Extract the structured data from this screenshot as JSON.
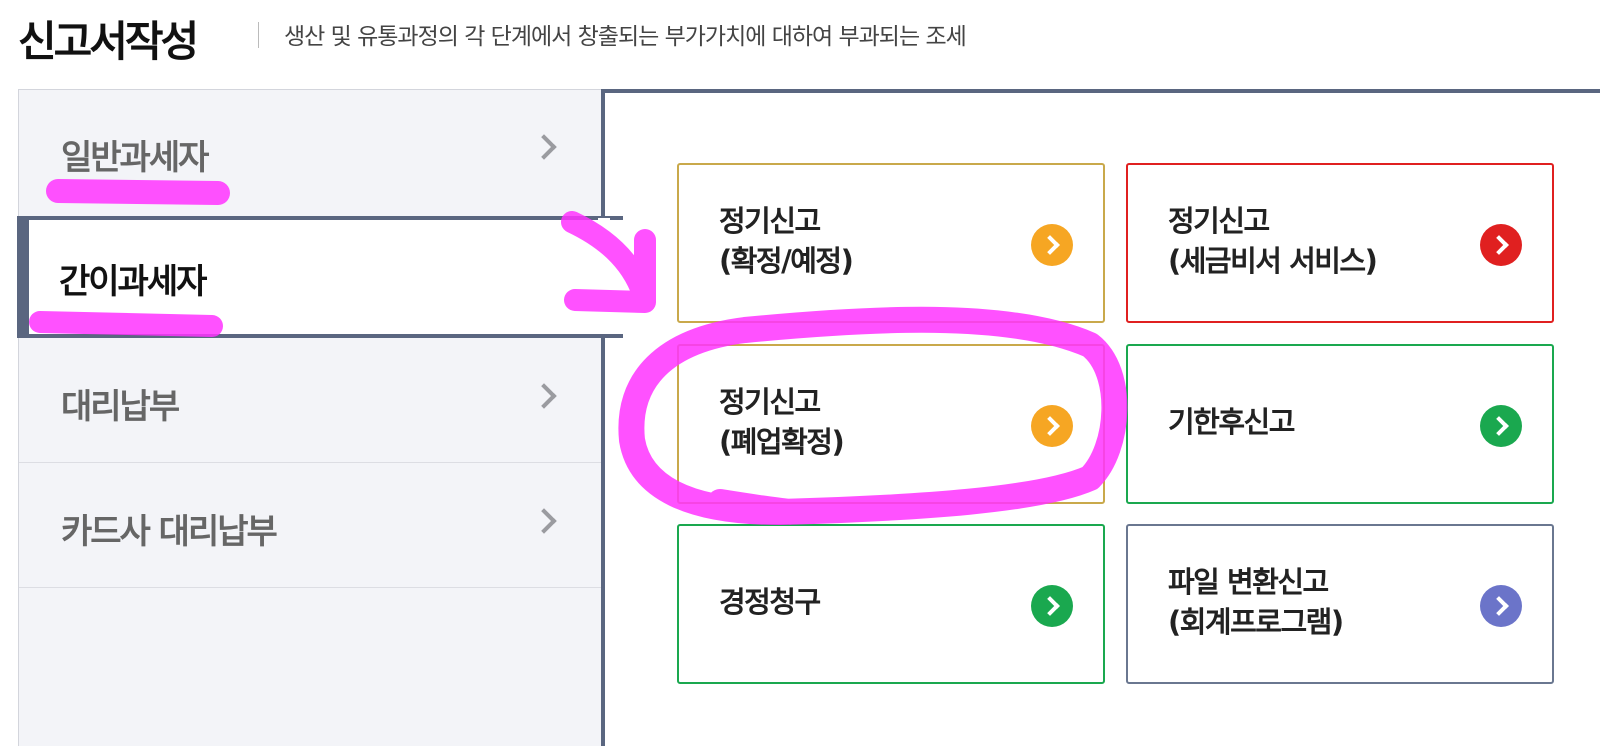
{
  "header": {
    "title": "신고서작성",
    "description": "생산 및 유통과정의 각 단계에서 창출되는 부가가치에 대하여 부과되는 조세"
  },
  "sidebar": {
    "items": [
      {
        "label": "일반과세자",
        "active": false
      },
      {
        "label": "간이과세자",
        "active": true
      },
      {
        "label": "대리납부",
        "active": false
      },
      {
        "label": "카드사 대리납부",
        "active": false
      }
    ]
  },
  "cards": [
    {
      "line1": "정기신고",
      "line2": "(확정/예정)",
      "color": "#f6a623",
      "border": "#c9a94b",
      "icon": "chevron-right-icon"
    },
    {
      "line1": "정기신고",
      "line2": "(세금비서 서비스)",
      "color": "#e02020",
      "border": "#e02020",
      "icon": "chevron-right-icon"
    },
    {
      "line1": "정기신고",
      "line2": "(폐업확정)",
      "color": "#f6a623",
      "border": "#c9a94b",
      "icon": "chevron-right-icon"
    },
    {
      "line1": "기한후신고",
      "line2": "",
      "color": "#1aa84f",
      "border": "#1aa84f",
      "icon": "chevron-right-icon"
    },
    {
      "line1": "경정청구",
      "line2": "",
      "color": "#1aa84f",
      "border": "#1aa84f",
      "icon": "chevron-right-icon"
    },
    {
      "line1": "파일 변환신고",
      "line2": "(회계프로그램)",
      "color": "#6b74c9",
      "border": "#6a7790",
      "icon": "chevron-right-icon"
    }
  ],
  "annotation_color": "#ff33ff"
}
